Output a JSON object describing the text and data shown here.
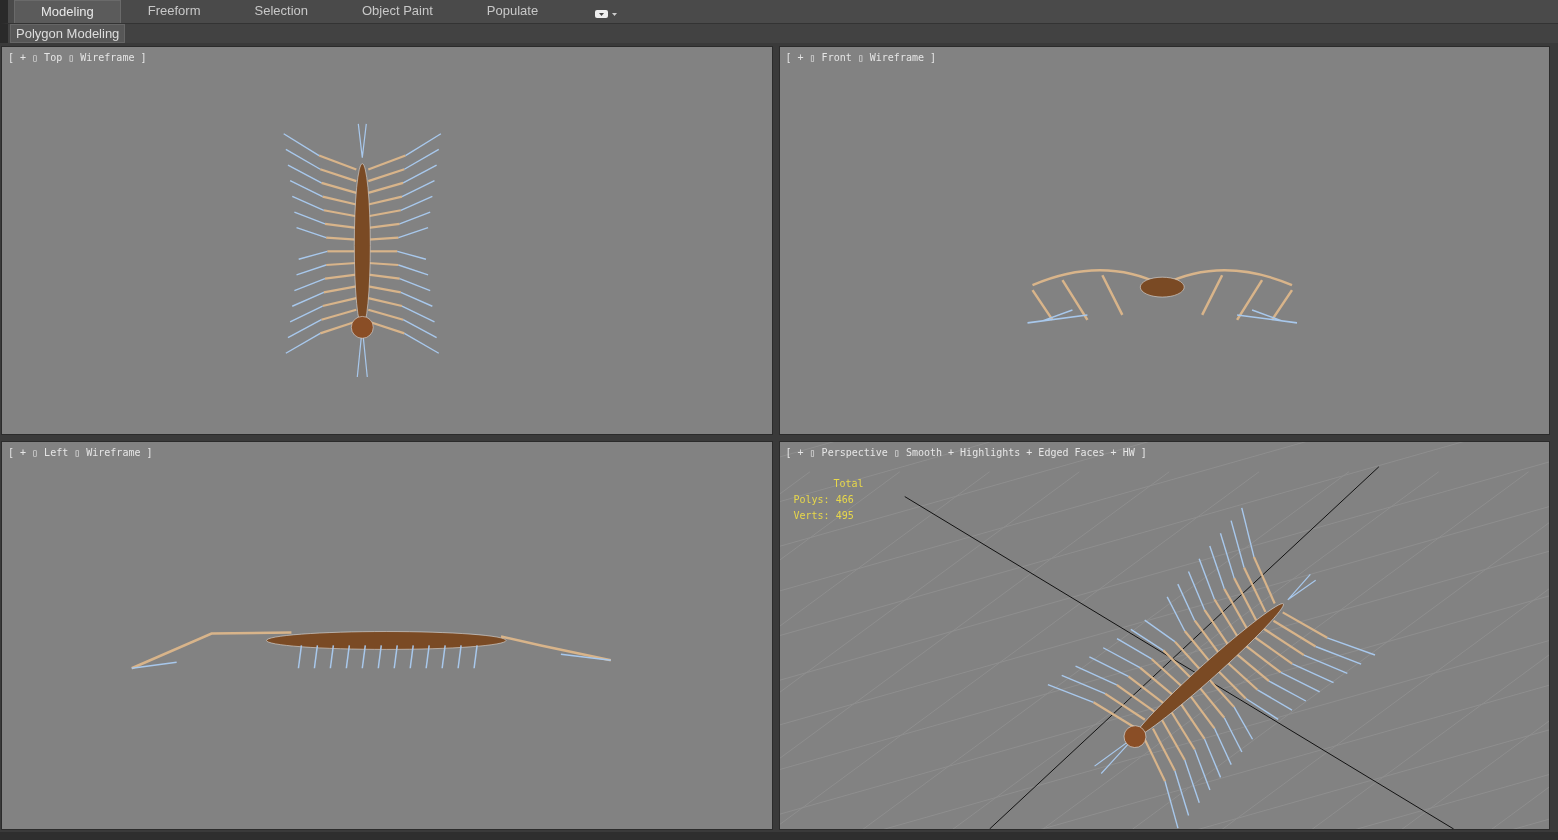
{
  "ribbon": {
    "tabs": [
      {
        "label": "Modeling",
        "selected": true
      },
      {
        "label": "Freeform",
        "selected": false
      },
      {
        "label": "Selection",
        "selected": false
      },
      {
        "label": "Object Paint",
        "selected": false
      },
      {
        "label": "Populate",
        "selected": false
      }
    ],
    "subtabs": [
      {
        "label": "Polygon Modeling",
        "selected": true
      }
    ]
  },
  "viewports": [
    {
      "kind": "top",
      "label": "[ + ▯ Top ▯ Wireframe ]"
    },
    {
      "kind": "front",
      "label": "[ + ▯ Front ▯ Wireframe ]"
    },
    {
      "kind": "left",
      "label": "[ + ▯ Left ▯ Wireframe ]"
    },
    {
      "kind": "perspective",
      "label": "[ + ▯ Perspective ▯ Smooth + Highlights + Edged Faces + HW ]",
      "stats": {
        "title": "Total",
        "rows": [
          {
            "label": "Polys:",
            "value": "466"
          },
          {
            "label": "Verts:",
            "value": "495"
          }
        ]
      }
    }
  ]
}
